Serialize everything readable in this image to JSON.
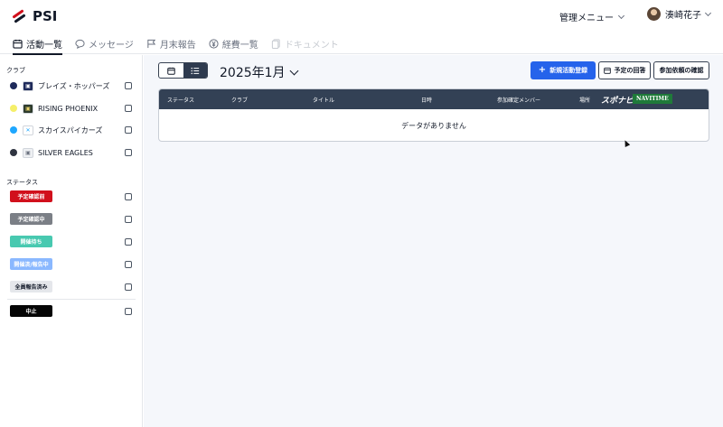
{
  "header": {
    "logo_text": "PSI",
    "admin_menu_label": "管理メニュー",
    "user_name": "湊崎花子"
  },
  "tabs": [
    {
      "label": "活動一覧",
      "icon": "calendar-icon",
      "state": "active"
    },
    {
      "label": "メッセージ",
      "icon": "message-bubble-icon",
      "state": "normal"
    },
    {
      "label": "月末報告",
      "icon": "flag-icon",
      "state": "normal"
    },
    {
      "label": "経費一覧",
      "icon": "yen-icon",
      "state": "normal"
    },
    {
      "label": "ドキュメント",
      "icon": "document-icon",
      "state": "disabled"
    }
  ],
  "sidebar": {
    "club_title": "クラブ",
    "clubs": [
      {
        "name": "ブレイズ・ホッパーズ",
        "color": "#1e2a5a",
        "logo": "▣"
      },
      {
        "name": "RISING PHOENIX",
        "color": "#f5ef6a",
        "logo": "▣"
      },
      {
        "name": "スカイスパイカーズ",
        "color": "#1ea7ff",
        "logo": "✕"
      },
      {
        "name": "SILVER EAGLES",
        "color": "#2f3440",
        "logo": "▣"
      }
    ],
    "status_title": "ステータス",
    "statuses": [
      {
        "label": "予定確認前",
        "bg": "#d1101c",
        "fg": "#ffffff"
      },
      {
        "label": "予定確認中",
        "bg": "#7b7f86",
        "fg": "#ffffff"
      },
      {
        "label": "開催待ち",
        "bg": "#48c9b0",
        "fg": "#ffffff"
      },
      {
        "label": "開催済/報告中",
        "bg": "#8ab8ff",
        "fg": "#ffffff"
      },
      {
        "label": "全員報告済み",
        "bg": "#e5e7eb",
        "fg": "#111827"
      },
      {
        "label": "中止",
        "bg": "#050505",
        "fg": "#ffffff"
      }
    ]
  },
  "main": {
    "month_label": "2025年1月",
    "buttons": {
      "new_activity": "新規活動登録",
      "schedule_answer": "予定の回答",
      "confirm_request": "参加依頼の確認"
    },
    "table": {
      "columns": [
        "ステータス",
        "クラブ",
        "タイトル",
        "日時",
        "参加確定メンバー",
        "場所"
      ],
      "sponsor_1": "スポナビ",
      "sponsor_2": "NAVITIME",
      "empty_message": "データがありません"
    }
  },
  "colors": {
    "primary": "#2563eb",
    "header_dark": "#334155",
    "background": "#f5f7fb"
  }
}
